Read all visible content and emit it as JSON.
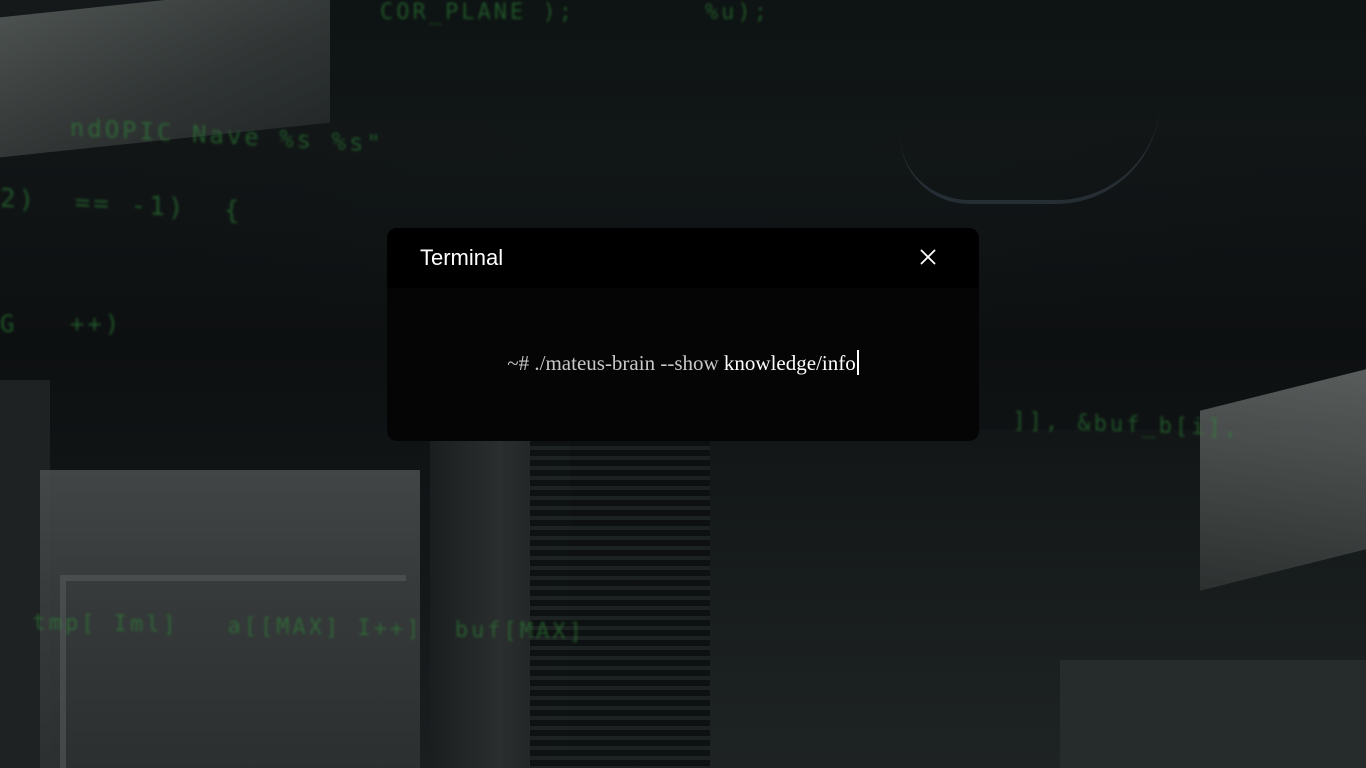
{
  "background": {
    "description_icon": "code-monitor-background",
    "code_fragments": [
      "COR_PLANE );        %u);",
      "    ndOPIC Nave %s %s\"",
      "2)  == -1)  {",
      "G   ++)",
      "  ]], &buf_b[i],",
      "  tmp[ Iml]   a[[MAX] I++]  buf[MAX]"
    ]
  },
  "terminal": {
    "title": "Terminal",
    "close_icon": "close-icon",
    "prompt": "~#",
    "command": "./mateus-brain --show",
    "argument": "knowledge/info"
  },
  "colors": {
    "dialog_background": "#050505",
    "header_background": "#000000",
    "text_primary": "#ffffff",
    "text_muted": "#c8c8c8",
    "code_green": "#2f8a3a"
  }
}
